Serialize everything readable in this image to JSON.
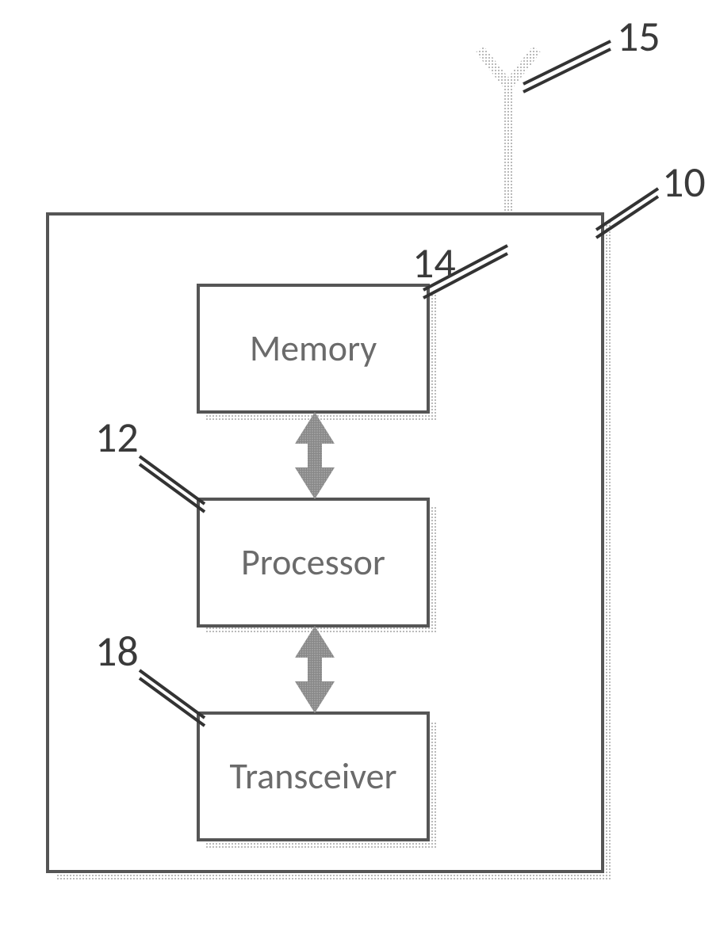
{
  "labels": {
    "antenna": "15",
    "device": "10",
    "memory_num": "14",
    "processor_num": "12",
    "transceiver_num": "18",
    "memory": "Memory",
    "processor": "Processor",
    "transceiver": "Transceiver"
  }
}
